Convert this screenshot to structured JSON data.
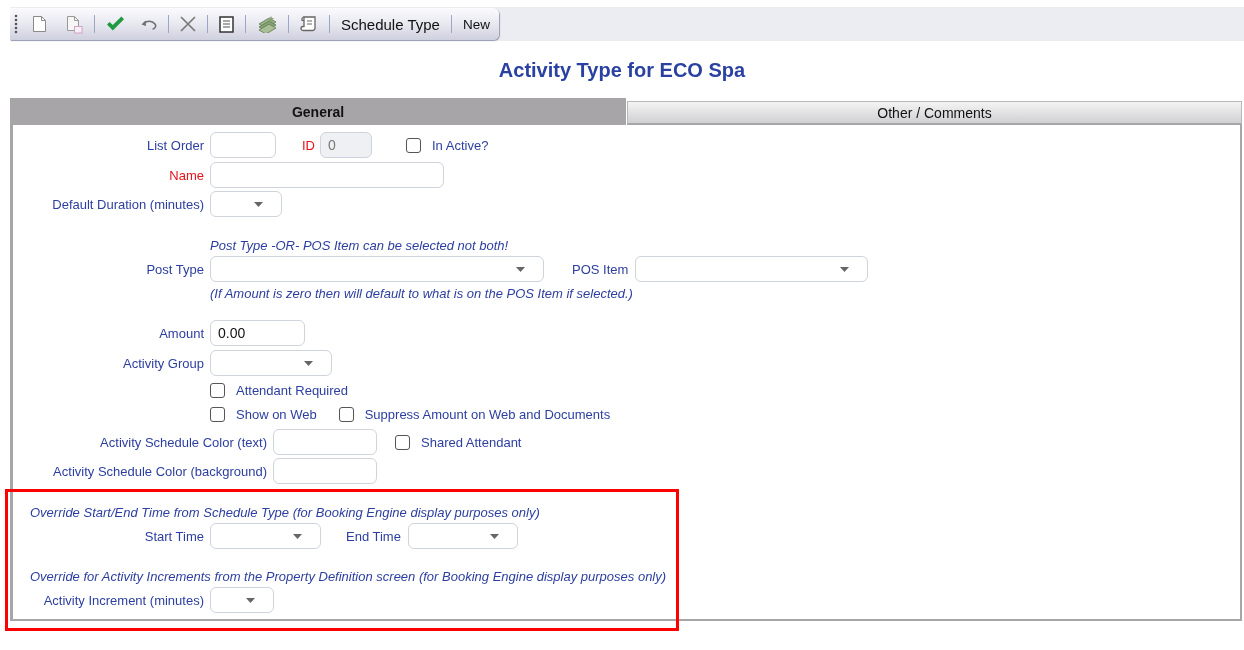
{
  "toolbar": {
    "caption": "Schedule Type",
    "button": "New"
  },
  "title": "Activity Type for ECO Spa",
  "tabs": [
    {
      "label": "General",
      "selected": true
    },
    {
      "label": "Other / Comments",
      "selected": false
    }
  ],
  "general": {
    "list_order": {
      "label": "List Order",
      "required": false
    },
    "id": {
      "label": "ID",
      "required": true,
      "value": "0",
      "disabled": true
    },
    "in_active": {
      "label": "In Active?",
      "checked": false
    },
    "name": {
      "label": "Name",
      "required": true
    },
    "default_duration": {
      "label": "Default Duration (minutes)",
      "required": false
    },
    "post_note": "Post Type -OR- POS Item can be selected not both!",
    "post_type": {
      "label": "Post Type",
      "required": false
    },
    "pos_item": {
      "label": "POS Item",
      "required": false
    },
    "amount_note": "(If Amount is zero then will default to what is on the POS Item if selected.)",
    "amount": {
      "label": "Amount",
      "required": false,
      "value": "0.00"
    },
    "activity_group": {
      "label": "Activity Group",
      "required": false
    },
    "attendant_required": {
      "label": "Attendant Required",
      "checked": false
    },
    "show_on_web": {
      "label": "Show on Web",
      "checked": false
    },
    "suppress_amount": {
      "label": "Suppress Amount on Web and Documents",
      "checked": false
    },
    "schedule_color_text": {
      "label": "Activity Schedule Color (text)",
      "required": false
    },
    "shared_attendant": {
      "label": "Shared Attendant",
      "checked": false
    },
    "schedule_color_background": {
      "label": "Activity Schedule Color (background)",
      "required": false
    }
  },
  "override_section": {
    "highlighted": true,
    "time_note": "Override Start/End Time from Schedule Type (for Booking Engine display purposes only)",
    "start_time": {
      "label": "Start Time",
      "required": false
    },
    "end_time": {
      "label": "End Time",
      "required": false
    },
    "increment_note": "Override for Activity Increments from the Property Definition screen (for Booking Engine display purposes only)",
    "activity_increment": {
      "label": "Activity Increment (minutes)",
      "required": false
    }
  }
}
